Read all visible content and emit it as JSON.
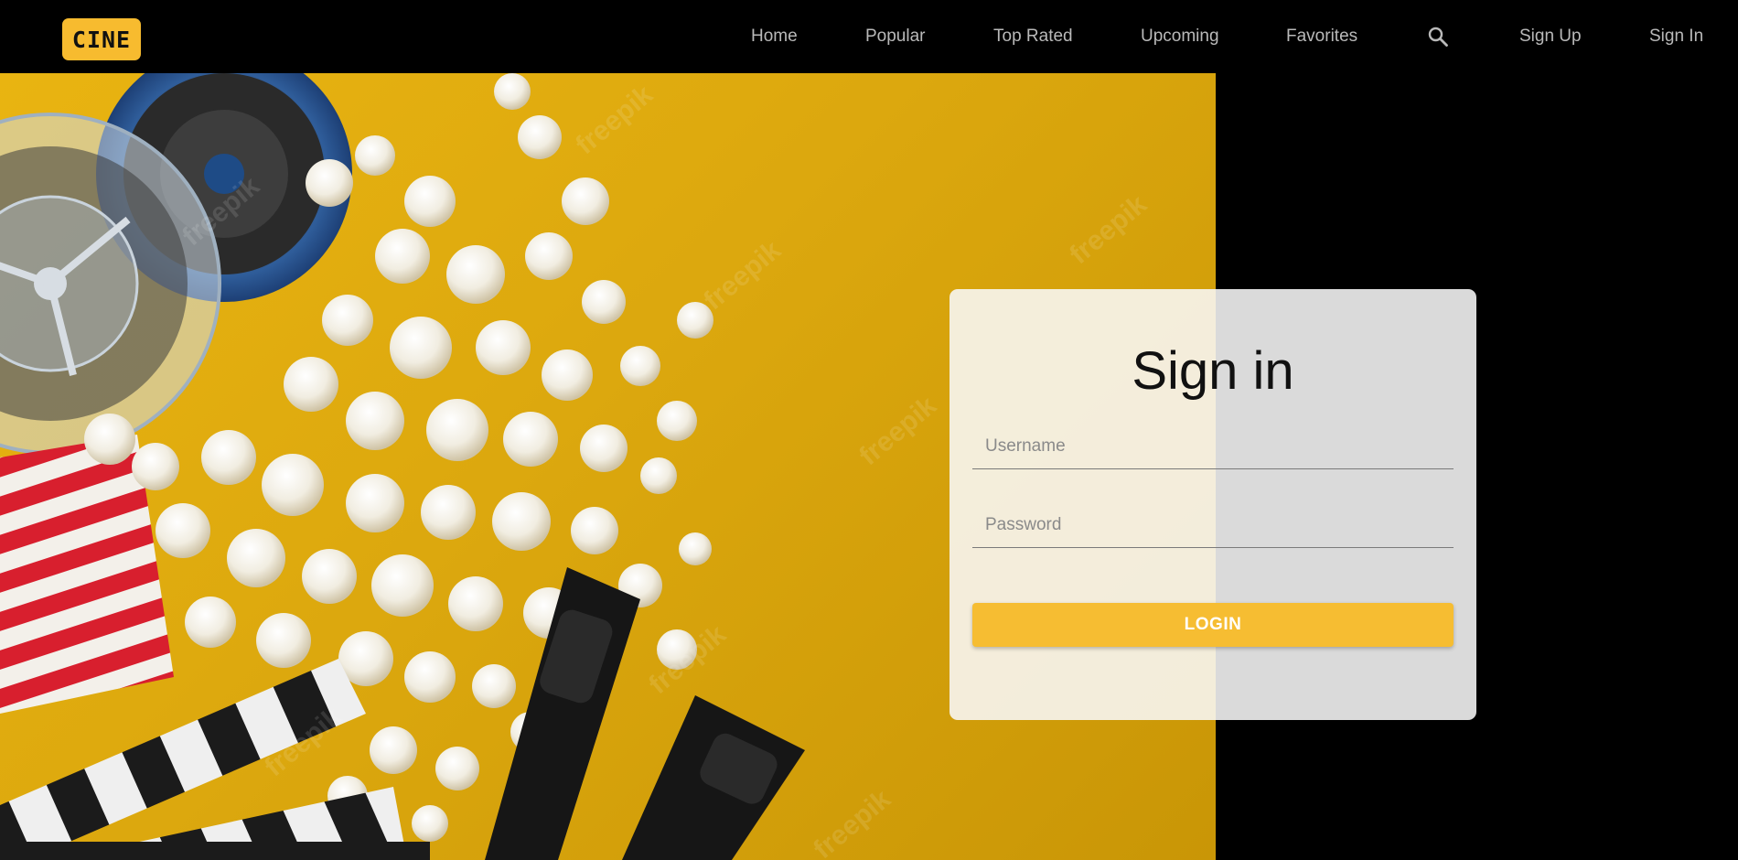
{
  "brand": {
    "logo_text": "CINE"
  },
  "nav": {
    "items": [
      {
        "label": "Home"
      },
      {
        "label": "Popular"
      },
      {
        "label": "Top Rated"
      },
      {
        "label": "Upcoming"
      },
      {
        "label": "Favorites"
      }
    ],
    "search_icon": "search-icon",
    "sign_up": "Sign Up",
    "sign_in": "Sign In"
  },
  "hero": {
    "description_icons": [
      "film-reel-icon",
      "popcorn-icon",
      "popcorn-box-icon",
      "clapperboard-icon",
      "3d-glasses-icon"
    ],
    "watermark_icon": "freepik-watermark-icon"
  },
  "form": {
    "title": "Sign in",
    "username_placeholder": "Username",
    "password_placeholder": "Password",
    "login_label": "LOGIN"
  },
  "colors": {
    "accent": "#f6bd32",
    "background": "#000000",
    "hero_yellow": "#e1ad0e",
    "nav_text": "#b9b9b9"
  }
}
